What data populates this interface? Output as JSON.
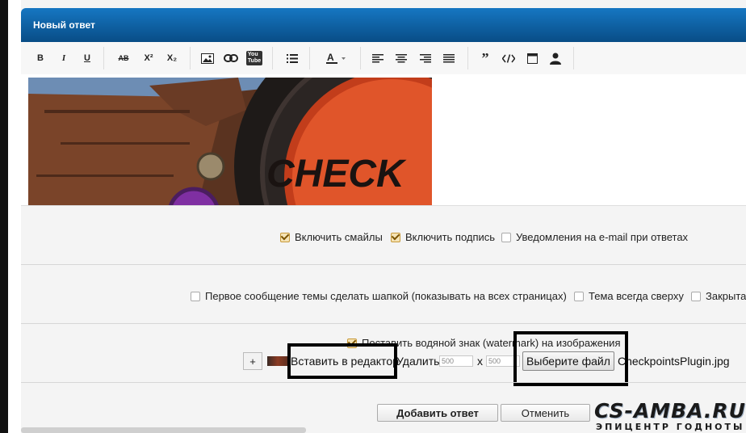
{
  "header": {
    "title": "Новый ответ"
  },
  "toolbar": {
    "bold": "B",
    "italic": "I",
    "underline": "U",
    "strike": "AB",
    "superscript": "X²",
    "subscript": "X₂",
    "youtube": "You Tube",
    "quote": "”"
  },
  "image": {
    "sign_text": "CHECK"
  },
  "options_row1": [
    {
      "label": "Включить смайлы",
      "checked": true
    },
    {
      "label": "Включить подпись",
      "checked": true
    },
    {
      "label": "Уведомления на e-mail при ответах",
      "checked": false
    }
  ],
  "options_row2": [
    {
      "label": "Первое сообщение темы сделать шапкой (показывать на всех страницах)",
      "checked": false
    },
    {
      "label": "Тема всегда сверху",
      "checked": false
    },
    {
      "label": "Закрыта",
      "checked": false
    }
  ],
  "attachment": {
    "watermark_label": "Поставить водяной знак (watermark) на изображения",
    "watermark_checked": true,
    "add_label": "+",
    "insert_label": "Вставить в редактор",
    "delete_label": "Удалить",
    "width": "500",
    "height": "500",
    "times": "x",
    "choose_file_label": "Выберите файл",
    "file_name": "CheckpointsPlugin.jpg"
  },
  "actions": {
    "submit_label": "Добавить ответ",
    "cancel_label": "Отменить"
  },
  "watermark_logo": {
    "text": "CS-AMBA.RU",
    "subtitle": "ЭПИЦЕНТР ГОДНОТЫ"
  },
  "colors": {
    "header": "#0b5a9a",
    "highlight_box": "#000000",
    "checkbox_checked": "#f5e3b5"
  }
}
